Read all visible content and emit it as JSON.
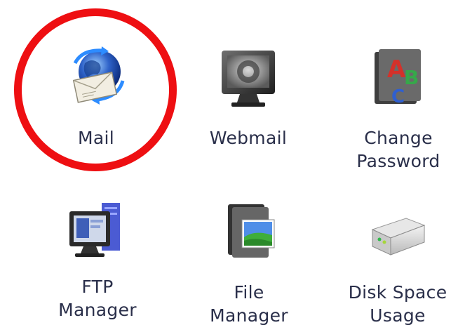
{
  "items": [
    {
      "key": "mail",
      "line1": "Mail",
      "line2": ""
    },
    {
      "key": "webmail",
      "line1": "Webmail",
      "line2": ""
    },
    {
      "key": "change-password",
      "line1": "Change",
      "line2": "Password"
    },
    {
      "key": "ftp-manager",
      "line1": "FTP",
      "line2": "Manager"
    },
    {
      "key": "file-manager",
      "line1": "File",
      "line2": "Manager"
    },
    {
      "key": "disk-space-usage",
      "line1": "Disk Space",
      "line2": "Usage"
    }
  ],
  "highlight": {
    "target": "mail",
    "color": "#ee0f12"
  },
  "icons": {
    "mail": "globe-envelope-icon",
    "webmail": "monitor-icon",
    "change-password": "abc-folder-icon",
    "ftp-manager": "computer-icon",
    "file-manager": "picture-folder-icon",
    "disk-space-usage": "hard-drive-icon"
  }
}
